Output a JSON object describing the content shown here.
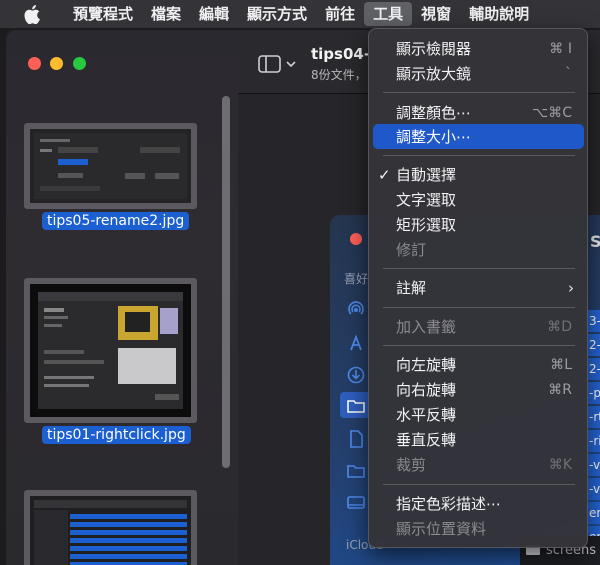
{
  "menubar": {
    "apple_icon": "apple-icon",
    "items": [
      "預覽程式",
      "檔案",
      "編輯",
      "顯示方式",
      "前往",
      "工具",
      "視窗",
      "輔助說明"
    ],
    "active_index": 5
  },
  "sidebar": {
    "thumbnails": [
      {
        "name": "tips05-rename2.jpg"
      },
      {
        "name": "tips01-rightclick.jpg"
      },
      {
        "name": ""
      }
    ]
  },
  "toolbar": {
    "title": "tips04-",
    "subtitle": "8份文件，"
  },
  "finder": {
    "section_favorites": "喜好",
    "section_icloud": "iCloud",
    "row_suffixes": [
      "3-",
      "2-",
      "2-",
      "-p",
      "-rt",
      "-ri",
      "-v",
      "-v",
      "ens",
      "ens"
    ],
    "bottom_file": "screens",
    "corner_letter": "S"
  },
  "menu": {
    "items": [
      {
        "label": "顯示檢閱器",
        "shortcut": "⌘ I",
        "disabled": false
      },
      {
        "label": "顯示放大鏡",
        "shortcut": "`",
        "disabled": false
      },
      {
        "label": "調整顏色⋯",
        "shortcut": "⌥⌘C",
        "disabled": false
      },
      {
        "label": "調整大小⋯",
        "shortcut": "",
        "disabled": false,
        "highlighted": true
      },
      {
        "label": "自動選擇",
        "shortcut": "",
        "checked": true
      },
      {
        "label": "文字選取",
        "shortcut": ""
      },
      {
        "label": "矩形選取",
        "shortcut": ""
      },
      {
        "label": "修訂",
        "shortcut": "",
        "disabled": true
      },
      {
        "label": "註解",
        "shortcut": "",
        "submenu": true
      },
      {
        "label": "加入書籤",
        "shortcut": "⌘D",
        "disabled": true
      },
      {
        "label": "向左旋轉",
        "shortcut": "⌘L"
      },
      {
        "label": "向右旋轉",
        "shortcut": "⌘R"
      },
      {
        "label": "水平反轉",
        "shortcut": ""
      },
      {
        "label": "垂直反轉",
        "shortcut": ""
      },
      {
        "label": "裁剪",
        "shortcut": "⌘K",
        "disabled": true
      },
      {
        "label": "指定色彩描述⋯",
        "shortcut": ""
      },
      {
        "label": "顯示位置資料",
        "shortcut": "",
        "disabled": true
      }
    ],
    "check_mark": "✓",
    "submenu_arrow": "›"
  },
  "colors": {
    "highlight": "#1f59c9",
    "selection": "#1b5fd1",
    "traffic_red": "#ff5f57",
    "traffic_yellow": "#febc2e",
    "traffic_green": "#28c840"
  }
}
